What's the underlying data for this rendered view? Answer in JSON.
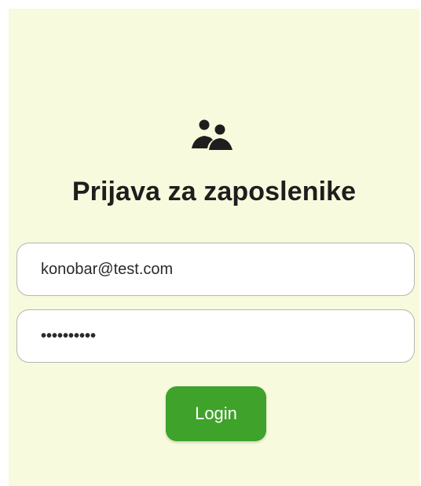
{
  "login": {
    "icon": "users-icon",
    "title": "Prijava za zaposlenike",
    "email_value": "konobar@test.com",
    "password_masked": "••••••••••",
    "login_label": "Login"
  },
  "colors": {
    "background": "#f7fadc",
    "button": "#3fa22a",
    "text": "#1e1e1e"
  }
}
